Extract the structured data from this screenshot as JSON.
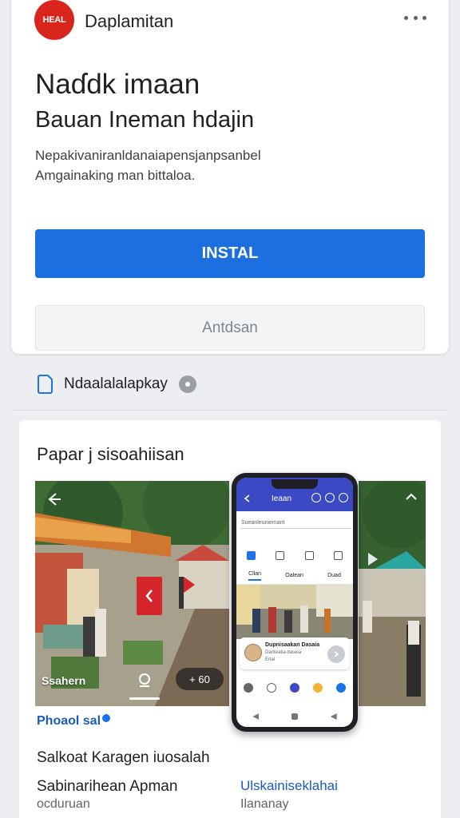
{
  "app": {
    "icon_text": "HEAL",
    "name": "Daplamitan"
  },
  "header": {
    "more_icon": "more-horiz-icon"
  },
  "listing": {
    "title": "Naɗdk imaan",
    "subtitle": "Bauan Ineman hdajin",
    "description_line1": "Nepakivaniranldanaiapensjanpsanbel",
    "description_line2": "Amgainaking man bittaloa."
  },
  "actions": {
    "install_label": "INSTAL",
    "secondary_label": "Antdsan"
  },
  "info": {
    "label": "Ndaalalalapkay",
    "icon": "document-icon"
  },
  "gallery": {
    "title": "Papar j sisoahiisan",
    "left_caption": "Ssahern",
    "left_pill": "+ 60",
    "left_label": "Phoaol sal",
    "phone": {
      "bar_title": "Ieaan",
      "search_text": "Sueanleuniemarit",
      "subtabs": [
        "Cllan",
        "Oalean",
        "Duad"
      ],
      "card_title": "Dupnisaakan Dasaia",
      "card_sub": "Danteatia daseia",
      "card_sub2": "Erlal"
    }
  },
  "rows": {
    "line1": "Salkoat Karagen iuosalah",
    "line2": "Sabinarihean Apman",
    "line3": "ocduruan",
    "link": "Ulskainiseklahai",
    "link_sub": "Ilananay"
  },
  "colors": {
    "accent": "#1b6fe0",
    "brand_red": "#d9261c",
    "phone_bar": "#3b4ac4"
  }
}
